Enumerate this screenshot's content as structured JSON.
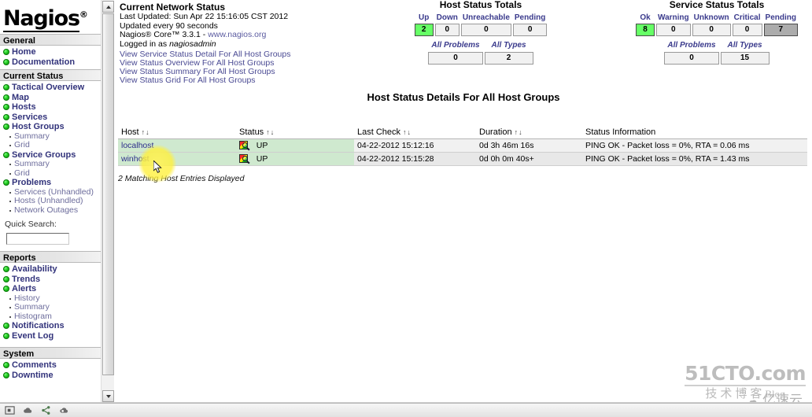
{
  "brand": {
    "logo": "Nagios",
    "registered": "®"
  },
  "sidebar": {
    "sections": [
      {
        "title": "General",
        "items": [
          {
            "label": "Home",
            "subitems": []
          },
          {
            "label": "Documentation",
            "subitems": []
          }
        ]
      },
      {
        "title": "Current Status",
        "items": [
          {
            "label": "Tactical Overview",
            "subitems": []
          },
          {
            "label": "Map",
            "subitems": []
          },
          {
            "label": "Hosts",
            "subitems": []
          },
          {
            "label": "Services",
            "subitems": []
          },
          {
            "label": "Host Groups",
            "subitems": [
              "Summary",
              "Grid"
            ]
          },
          {
            "label": "Service Groups",
            "subitems": [
              "Summary",
              "Grid"
            ]
          },
          {
            "label": "Problems",
            "subitems": [
              "Services (Unhandled)",
              "Hosts (Unhandled)",
              "Network Outages"
            ]
          }
        ]
      },
      {
        "title": "Reports",
        "items": [
          {
            "label": "Availability",
            "subitems": []
          },
          {
            "label": "Trends",
            "subitems": []
          },
          {
            "label": "Alerts",
            "subitems": [
              "History",
              "Summary",
              "Histogram"
            ]
          },
          {
            "label": "Notifications",
            "subitems": []
          },
          {
            "label": "Event Log",
            "subitems": []
          }
        ]
      },
      {
        "title": "System",
        "items": [
          {
            "label": "Comments",
            "subitems": []
          },
          {
            "label": "Downtime",
            "subitems": []
          }
        ]
      }
    ],
    "quick_search": {
      "label": "Quick Search:",
      "value": "",
      "placeholder": ""
    }
  },
  "network_status": {
    "title": "Current Network Status",
    "last_updated_label": "Last Updated:",
    "last_updated_value": "Sun Apr 22 15:16:05 CST 2012",
    "update_interval": "Updated every 90 seconds",
    "version_prefix": "Nagios® Core™ 3.3.1 -",
    "version_link": "www.nagios.org",
    "logged_in_label": "Logged in as",
    "logged_in_user": "nagiosadmin",
    "links": [
      "View Service Status Detail For All Host Groups",
      "View Status Overview For All Host Groups",
      "View Status Summary For All Host Groups",
      "View Status Grid For All Host Groups"
    ]
  },
  "host_totals": {
    "title": "Host Status Totals",
    "headers": [
      "Up",
      "Down",
      "Unreachable",
      "Pending"
    ],
    "values": [
      "2",
      "0",
      "0",
      "0"
    ],
    "sub_headers": [
      "All Problems",
      "All Types"
    ],
    "sub_values": [
      "0",
      "2"
    ]
  },
  "service_totals": {
    "title": "Service Status Totals",
    "headers": [
      "Ok",
      "Warning",
      "Unknown",
      "Critical",
      "Pending"
    ],
    "values": [
      "8",
      "0",
      "0",
      "0",
      "7"
    ],
    "sub_headers": [
      "All Problems",
      "All Types"
    ],
    "sub_values": [
      "0",
      "15"
    ]
  },
  "page": {
    "title": "Host Status Details For All Host Groups",
    "entries_note": "2 Matching Host Entries Displayed"
  },
  "table": {
    "columns": [
      "Host",
      "Status",
      "Last Check",
      "Duration",
      "Status Information"
    ],
    "sort_glyph": "↑↓",
    "rows": [
      {
        "host": "localhost",
        "status": "UP",
        "last_check": "04-22-2012 15:12:16",
        "duration": "0d 3h 46m 16s",
        "info": "PING OK - Packet loss = 0%, RTA = 0.06 ms"
      },
      {
        "host": "winhost",
        "status": "UP",
        "last_check": "04-22-2012 15:15:28",
        "duration": "0d 0h 0m 40s+",
        "info": "PING OK - Packet loss = 0%, RTA = 1.43 ms"
      }
    ]
  },
  "watermarks": {
    "primary": "51CTO.com",
    "primary_sub": "技术博客",
    "primary_sub_blog": "Blog",
    "secondary": "亿速云"
  },
  "colors": {
    "ok_green": "#66ff66",
    "pending_gray": "#acacac",
    "row_green": "#cfe9cf",
    "link_blue": "#32337b",
    "highlight_yellow": "#fff35c"
  }
}
